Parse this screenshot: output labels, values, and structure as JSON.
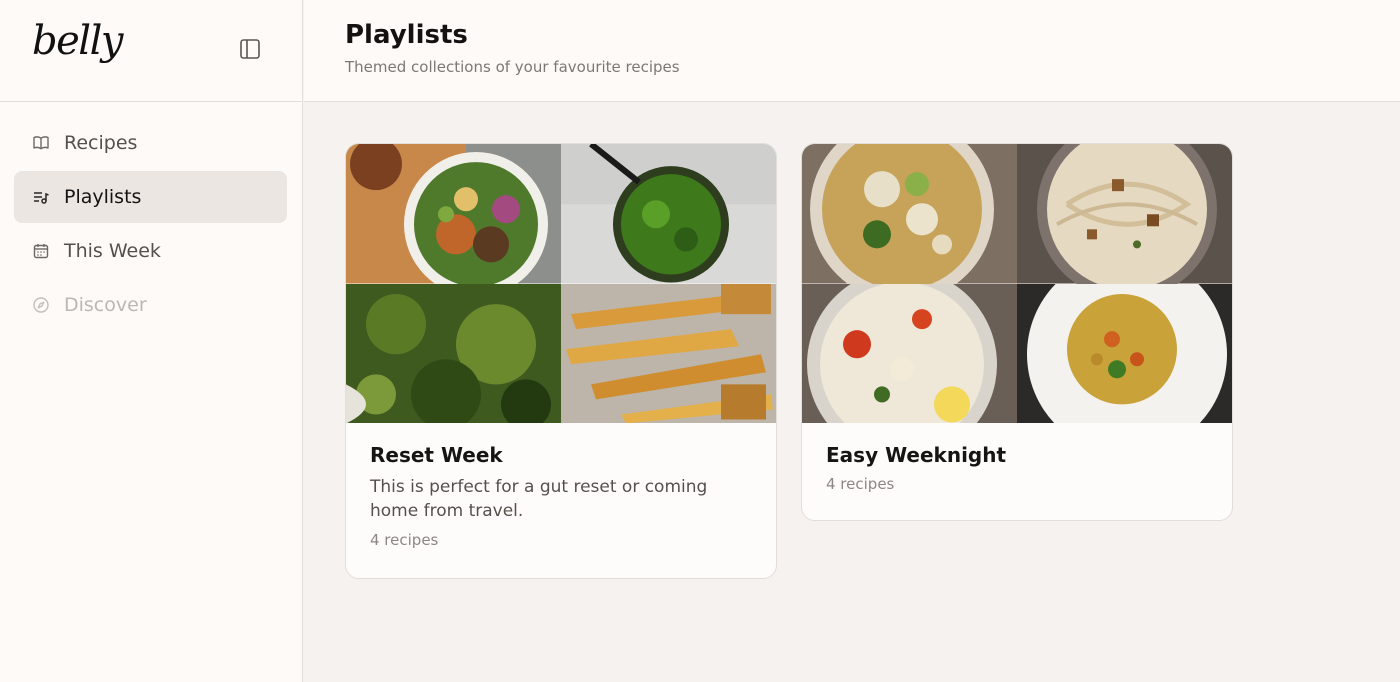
{
  "app": {
    "logo": "belly"
  },
  "sidebar": {
    "items": [
      {
        "label": "Recipes",
        "icon": "book-icon",
        "state": "normal"
      },
      {
        "label": "Playlists",
        "icon": "playlist-icon",
        "state": "active"
      },
      {
        "label": "This Week",
        "icon": "calendar-icon",
        "state": "normal"
      },
      {
        "label": "Discover",
        "icon": "compass-icon",
        "state": "disabled"
      }
    ]
  },
  "header": {
    "title": "Playlists",
    "subtitle": "Themed collections of your favourite recipes"
  },
  "playlists": [
    {
      "title": "Reset Week",
      "description": "This is perfect for a gut reset or coming home from travel.",
      "count": "4 recipes",
      "images": [
        "grain-bowl",
        "green-pesto-jar",
        "spinach-lentil-curry",
        "roasted-parsnips"
      ]
    },
    {
      "title": "Easy Weeknight",
      "description": "",
      "count": "4 recipes",
      "images": [
        "white-bean-stew",
        "creamy-tofu-pasta",
        "tomato-bean-pasta",
        "lentil-dal-rice"
      ]
    }
  ],
  "colors": {
    "background": "#f6f2ef",
    "sidebar": "#fdfaf8",
    "active_item": "#ece6e2",
    "border": "#e4dedb"
  }
}
